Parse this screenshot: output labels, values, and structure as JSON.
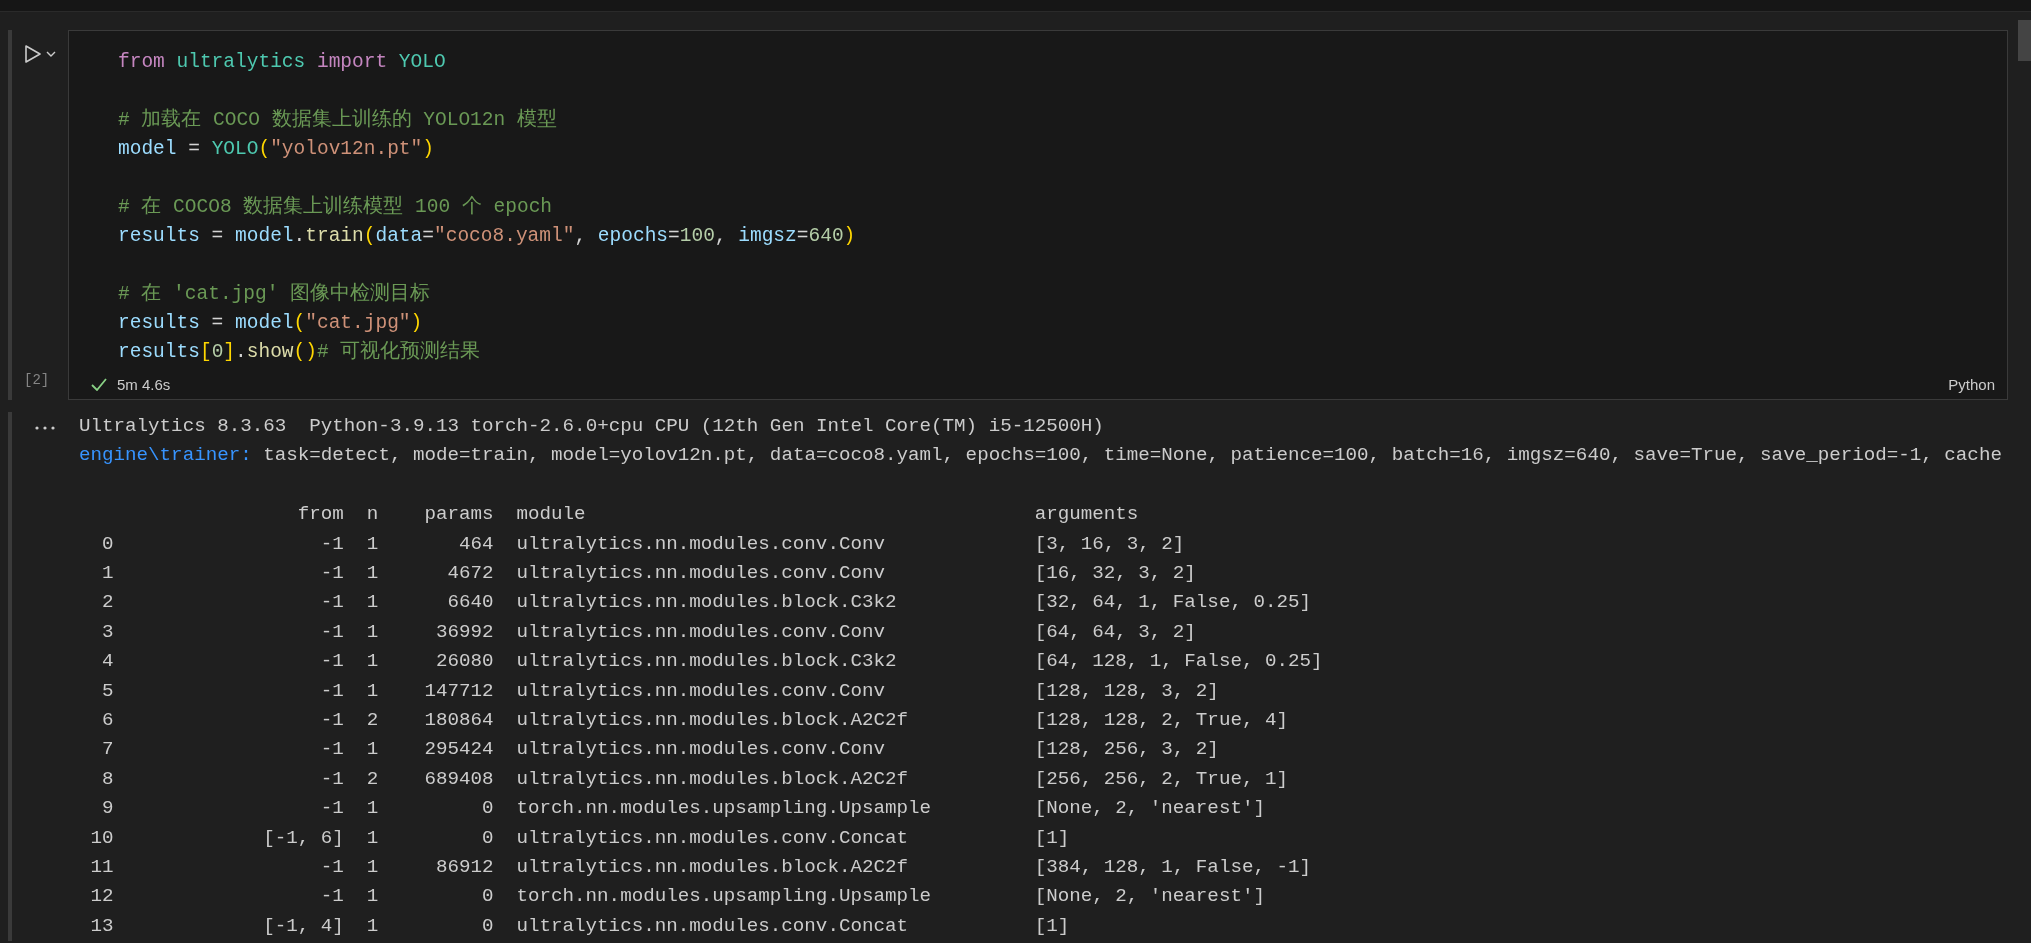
{
  "cell": {
    "execution_count": "[2]",
    "succeeded": true,
    "duration": "5m 4.6s",
    "language": "Python",
    "code_blocks": [
      [
        [
          {
            "text": "from",
            "kind": "keyword"
          },
          {
            "text": " ultralytics ",
            "kind": "class"
          },
          {
            "text": "import",
            "kind": "keyword"
          },
          {
            "text": " YOLO",
            "kind": "class"
          }
        ]
      ],
      [
        [
          {
            "text": "# 加载在 COCO 数据集上训练的 YOLO12n 模型",
            "kind": "comment"
          }
        ],
        [
          {
            "text": "model",
            "kind": "variable"
          },
          {
            "text": " = ",
            "kind": "plain"
          },
          {
            "text": "YOLO",
            "kind": "class"
          },
          {
            "text": "(",
            "kind": "bracket"
          },
          {
            "text": "\"yolov12n.pt\"",
            "kind": "string"
          },
          {
            "text": ")",
            "kind": "bracket"
          }
        ]
      ],
      [
        [
          {
            "text": "# 在 COCO8 数据集上训练模型 100 个 epoch",
            "kind": "comment"
          }
        ],
        [
          {
            "text": "results",
            "kind": "variable"
          },
          {
            "text": " = ",
            "kind": "plain"
          },
          {
            "text": "model",
            "kind": "variable"
          },
          {
            "text": ".",
            "kind": "plain"
          },
          {
            "text": "train",
            "kind": "function"
          },
          {
            "text": "(",
            "kind": "bracket"
          },
          {
            "text": "data",
            "kind": "variable"
          },
          {
            "text": "=",
            "kind": "plain"
          },
          {
            "text": "\"coco8.yaml\"",
            "kind": "string"
          },
          {
            "text": ", ",
            "kind": "plain"
          },
          {
            "text": "epochs",
            "kind": "variable"
          },
          {
            "text": "=",
            "kind": "plain"
          },
          {
            "text": "100",
            "kind": "number"
          },
          {
            "text": ", ",
            "kind": "plain"
          },
          {
            "text": "imgsz",
            "kind": "variable"
          },
          {
            "text": "=",
            "kind": "plain"
          },
          {
            "text": "640",
            "kind": "number"
          },
          {
            "text": ")",
            "kind": "bracket"
          }
        ]
      ],
      [
        [
          {
            "text": "# 在 'cat.jpg' 图像中检测目标",
            "kind": "comment"
          }
        ],
        [
          {
            "text": "results",
            "kind": "variable"
          },
          {
            "text": " = ",
            "kind": "plain"
          },
          {
            "text": "model",
            "kind": "variable"
          },
          {
            "text": "(",
            "kind": "bracket"
          },
          {
            "text": "\"cat.jpg\"",
            "kind": "string"
          },
          {
            "text": ")",
            "kind": "bracket"
          }
        ],
        [
          {
            "text": "results",
            "kind": "variable"
          },
          {
            "text": "[",
            "kind": "bracket"
          },
          {
            "text": "0",
            "kind": "number"
          },
          {
            "text": "]",
            "kind": "bracket"
          },
          {
            "text": ".",
            "kind": "plain"
          },
          {
            "text": "show",
            "kind": "function"
          },
          {
            "text": "()",
            "kind": "bracket"
          },
          {
            "text": "# 可视化预测结果",
            "kind": "comment"
          }
        ]
      ]
    ]
  },
  "output": {
    "header_line": "Ultralytics 8.3.63  Python-3.9.13 torch-2.6.0+cpu CPU (12th Gen Intel Core(TM) i5-12500H)",
    "trainer_prefix": "engine\\trainer:",
    "trainer_args": "task=detect, mode=train, model=yolov12n.pt, data=coco8.yaml, epochs=100, time=None, patience=100, batch=16, imgsz=640, save=True, save_period=-1, cache",
    "table": {
      "columns": [
        "",
        "from",
        "n",
        "params",
        "module",
        "arguments"
      ],
      "rows": [
        [
          "0",
          "-1",
          "1",
          "464",
          "ultralytics.nn.modules.conv.Conv",
          "[3, 16, 3, 2]"
        ],
        [
          "1",
          "-1",
          "1",
          "4672",
          "ultralytics.nn.modules.conv.Conv",
          "[16, 32, 3, 2]"
        ],
        [
          "2",
          "-1",
          "1",
          "6640",
          "ultralytics.nn.modules.block.C3k2",
          "[32, 64, 1, False, 0.25]"
        ],
        [
          "3",
          "-1",
          "1",
          "36992",
          "ultralytics.nn.modules.conv.Conv",
          "[64, 64, 3, 2]"
        ],
        [
          "4",
          "-1",
          "1",
          "26080",
          "ultralytics.nn.modules.block.C3k2",
          "[64, 128, 1, False, 0.25]"
        ],
        [
          "5",
          "-1",
          "1",
          "147712",
          "ultralytics.nn.modules.conv.Conv",
          "[128, 128, 3, 2]"
        ],
        [
          "6",
          "-1",
          "2",
          "180864",
          "ultralytics.nn.modules.block.A2C2f",
          "[128, 128, 2, True, 4]"
        ],
        [
          "7",
          "-1",
          "1",
          "295424",
          "ultralytics.nn.modules.conv.Conv",
          "[128, 256, 3, 2]"
        ],
        [
          "8",
          "-1",
          "2",
          "689408",
          "ultralytics.nn.modules.block.A2C2f",
          "[256, 256, 2, True, 1]"
        ],
        [
          "9",
          "-1",
          "1",
          "0",
          "torch.nn.modules.upsampling.Upsample",
          "[None, 2, 'nearest']"
        ],
        [
          "10",
          "[-1, 6]",
          "1",
          "0",
          "ultralytics.nn.modules.conv.Concat",
          "[1]"
        ],
        [
          "11",
          "-1",
          "1",
          "86912",
          "ultralytics.nn.modules.block.A2C2f",
          "[384, 128, 1, False, -1]"
        ],
        [
          "12",
          "-1",
          "1",
          "0",
          "torch.nn.modules.upsampling.Upsample",
          "[None, 2, 'nearest']"
        ],
        [
          "13",
          "[-1, 4]",
          "1",
          "0",
          "ultralytics.nn.modules.conv.Concat",
          "[1]"
        ]
      ]
    }
  }
}
